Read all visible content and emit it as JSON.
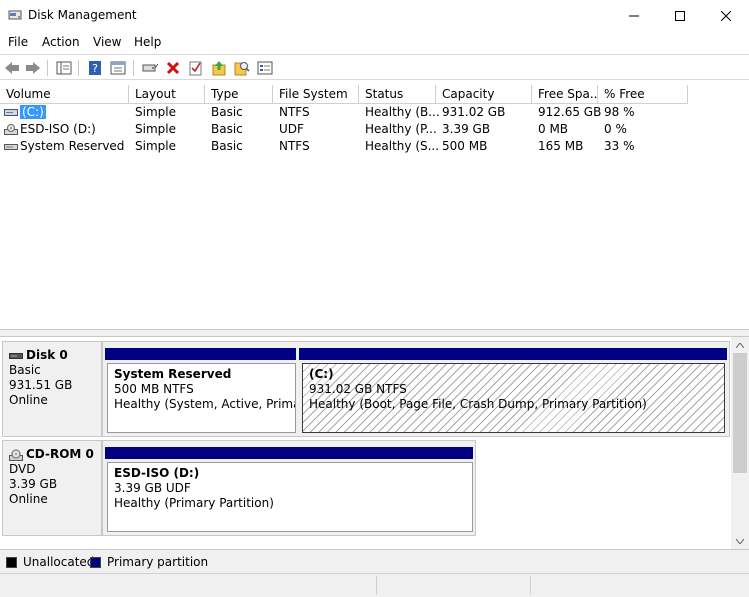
{
  "window": {
    "title": "Disk Management",
    "icons": {
      "app": "disk-management-icon",
      "minimize": "minimize-icon",
      "maximize": "maximize-icon",
      "close": "close-icon"
    }
  },
  "menu": [
    "File",
    "Action",
    "View",
    "Help"
  ],
  "toolbar": {
    "icons": [
      "back-icon",
      "forward-icon",
      "show-hide-tree-icon",
      "help-icon",
      "properties-view-icon",
      "connect-disk-icon",
      "delete-icon",
      "check-icon",
      "export-icon",
      "search-icon",
      "settings-panel-icon"
    ]
  },
  "volume_list": {
    "columns": [
      "Volume",
      "Layout",
      "Type",
      "File System",
      "Status",
      "Capacity",
      "Free Spa...",
      "% Free"
    ],
    "rows": [
      {
        "volume": "(C:)",
        "layout": "Simple",
        "type": "Basic",
        "fs": "NTFS",
        "status": "Healthy (B...",
        "capacity": "931.02 GB",
        "free": "912.65 GB",
        "pct": "98 %",
        "icon": "volume-icon",
        "selected": true
      },
      {
        "volume": "ESD-ISO (D:)",
        "layout": "Simple",
        "type": "Basic",
        "fs": "UDF",
        "status": "Healthy (P...",
        "capacity": "3.39 GB",
        "free": "0 MB",
        "pct": "0 %",
        "icon": "cd-volume-icon",
        "selected": false
      },
      {
        "volume": "System Reserved",
        "layout": "Simple",
        "type": "Basic",
        "fs": "NTFS",
        "status": "Healthy (S...",
        "capacity": "500 MB",
        "free": "165 MB",
        "pct": "33 %",
        "icon": "volume-icon",
        "selected": false
      }
    ]
  },
  "disks": [
    {
      "name": "Disk 0",
      "kind": "Basic",
      "size": "931.51 GB",
      "state": "Online",
      "icon": "hard-disk-icon",
      "partitions": [
        {
          "name": "System Reserved",
          "size": "500 MB NTFS",
          "status": "Healthy (System, Active, Primary P"
        },
        {
          "name": "(C:)",
          "size": "931.02 GB NTFS",
          "status": "Healthy (Boot, Page File, Crash Dump, Primary Partition)"
        }
      ]
    },
    {
      "name": "CD-ROM 0",
      "kind": "DVD",
      "size": "3.39 GB",
      "state": "Online",
      "icon": "cd-rom-icon",
      "partitions": [
        {
          "name": "ESD-ISO  (D:)",
          "size": "3.39 GB UDF",
          "status": "Healthy (Primary Partition)"
        }
      ]
    }
  ],
  "legend": [
    {
      "label": "Unallocated",
      "color": "#000000"
    },
    {
      "label": "Primary partition",
      "color": "#000080"
    }
  ],
  "colors": {
    "primary_partition": "#000080",
    "selection": "#3399ff"
  }
}
